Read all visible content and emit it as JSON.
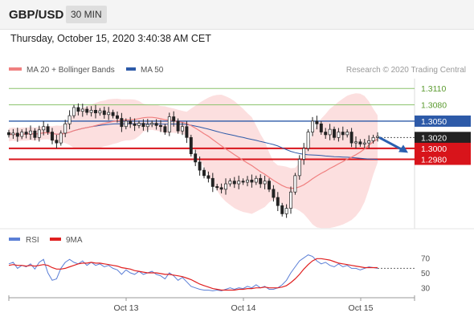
{
  "header": {
    "symbol": "GBP/USD",
    "timeframe": "30 MIN",
    "datetime": "Thursday, October 15, 2020 3:40:38 AM CET"
  },
  "legend": {
    "ma20_label": "MA 20 + Bollinger Bands",
    "ma50_label": "MA 50",
    "credit": "Research © 2020 Trading Central"
  },
  "colors": {
    "bull_candle": "#ffffff",
    "bear_candle": "#222222",
    "ma20": "#f08080",
    "bollinger_fill": "#fbd9d9",
    "ma50": "#2d5aa8",
    "support_line": "#d8141b",
    "resistance_line": "#2d5aa8",
    "target_line": "#8ac26b",
    "rsi": "#5b7fd6",
    "rsi_ma": "#e02020",
    "arrow": "#2b60b0"
  },
  "chart_data": [
    {
      "type": "candlestick",
      "title": "GBP/USD",
      "ylim": [
        1.286,
        1.3125
      ],
      "x_tick_labels": [
        "Oct 13",
        "Oct 14",
        "Oct 15"
      ],
      "levels": [
        {
          "value": 1.311,
          "label": "1.3110",
          "kind": "target"
        },
        {
          "value": 1.308,
          "label": "1.3080",
          "kind": "target"
        },
        {
          "value": 1.305,
          "label": "1.3050",
          "kind": "resistance"
        },
        {
          "value": 1.302,
          "label": "1.3020",
          "kind": "current_price"
        },
        {
          "value": 1.3,
          "label": "1.3000",
          "kind": "support"
        },
        {
          "value": 1.298,
          "label": "1.2980",
          "kind": "support"
        }
      ],
      "series": [
        {
          "name": "MA 20 + Bollinger Bands"
        },
        {
          "name": "MA 50"
        }
      ],
      "close_values": [
        1.3025,
        1.3028,
        1.3022,
        1.303,
        1.3026,
        1.3032,
        1.302,
        1.3034,
        1.304,
        1.303,
        1.3015,
        1.301,
        1.3028,
        1.3045,
        1.306,
        1.3075,
        1.3068,
        1.3072,
        1.3066,
        1.307,
        1.3065,
        1.3069,
        1.3062,
        1.3066,
        1.306,
        1.3055,
        1.304,
        1.305,
        1.3045,
        1.3042,
        1.3046,
        1.304,
        1.3044,
        1.3046,
        1.3042,
        1.304,
        1.303,
        1.3058,
        1.305,
        1.3032,
        1.304,
        1.302,
        1.299,
        1.2975,
        1.296,
        1.295,
        1.2945,
        1.293,
        1.2928,
        1.2925,
        1.2935,
        1.294,
        1.2935,
        1.294,
        1.2938,
        1.2942,
        1.2938,
        1.2945,
        1.2935,
        1.294,
        1.2925,
        1.291,
        1.2895,
        1.288,
        1.289,
        1.292,
        1.295,
        1.298,
        1.3,
        1.303,
        1.305,
        1.3045,
        1.303,
        1.3025,
        1.3035,
        1.302,
        1.303,
        1.3025,
        1.303,
        1.301,
        1.3012,
        1.3008,
        1.301,
        1.3014,
        1.302,
        1.3022
      ],
      "trend_arrow": {
        "from": 1.302,
        "to": 1.2992
      }
    },
    {
      "type": "line",
      "title": "RSI",
      "ylim": [
        20,
        80
      ],
      "y_ticks": [
        70,
        50,
        30
      ],
      "x_tick_labels": [
        "Oct 13",
        "Oct 14",
        "Oct 15"
      ],
      "series": [
        {
          "name": "RSI",
          "values": [
            62,
            64,
            56,
            60,
            58,
            62,
            55,
            64,
            68,
            50,
            40,
            42,
            56,
            64,
            68,
            64,
            62,
            66,
            60,
            64,
            60,
            62,
            58,
            60,
            56,
            54,
            48,
            54,
            50,
            48,
            52,
            48,
            50,
            52,
            48,
            46,
            42,
            50,
            46,
            40,
            44,
            38,
            32,
            30,
            28,
            27,
            27,
            26,
            27,
            26,
            28,
            30,
            28,
            30,
            29,
            32,
            30,
            34,
            30,
            32,
            28,
            28,
            30,
            34,
            40,
            50,
            58,
            66,
            70,
            74,
            72,
            66,
            62,
            64,
            60,
            58,
            62,
            58,
            60,
            56,
            56,
            54,
            56,
            58,
            57,
            56
          ]
        },
        {
          "name": "9MA",
          "values": [
            60,
            61,
            60,
            60,
            59,
            60,
            59,
            60,
            61,
            60,
            57,
            55,
            55,
            56,
            58,
            60,
            62,
            63,
            63,
            64,
            63,
            63,
            62,
            61,
            60,
            59,
            57,
            56,
            55,
            53,
            52,
            51,
            50,
            50,
            50,
            49,
            48,
            48,
            47,
            46,
            45,
            43,
            41,
            38,
            35,
            33,
            31,
            29,
            28,
            27,
            27,
            27,
            27,
            28,
            28,
            29,
            29,
            30,
            30,
            31,
            30,
            30,
            30,
            31,
            33,
            37,
            42,
            48,
            55,
            61,
            66,
            69,
            69,
            68,
            67,
            65,
            63,
            62,
            61,
            60,
            59,
            58,
            57,
            57,
            57,
            57
          ]
        }
      ]
    }
  ]
}
